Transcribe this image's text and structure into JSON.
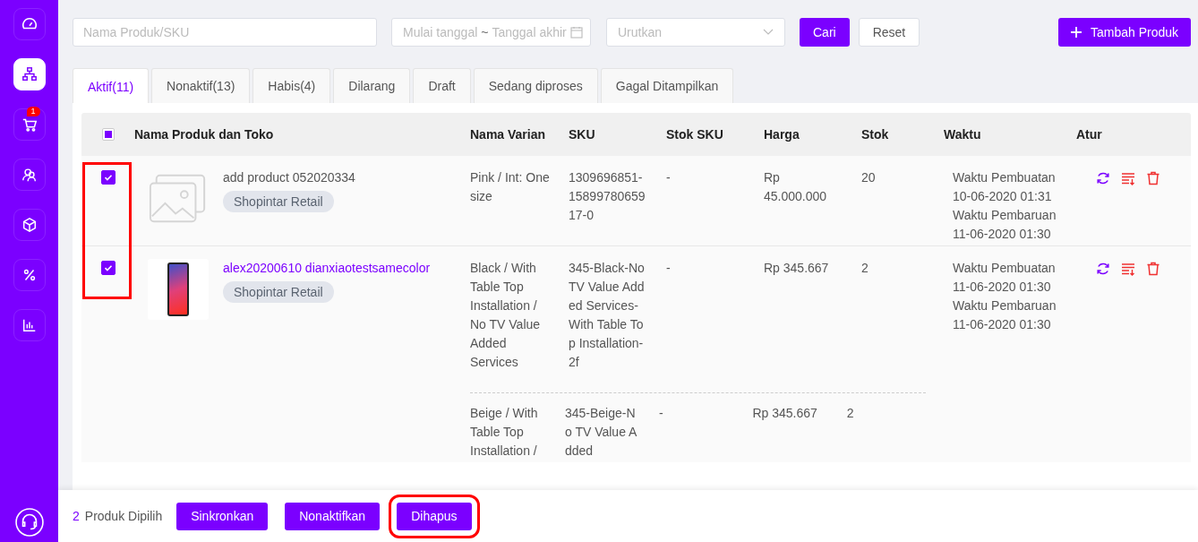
{
  "sidebar": {
    "items": [
      {
        "selected": false
      },
      {
        "selected": true
      },
      {
        "selected": false,
        "badge": "1"
      },
      {
        "selected": false
      },
      {
        "selected": false
      },
      {
        "selected": false
      },
      {
        "selected": false
      }
    ]
  },
  "filters": {
    "search": {
      "placeholder": "Nama Produk/SKU"
    },
    "date_start": {
      "placeholder": "Mulai tanggal"
    },
    "date_separator": "~",
    "date_end": {
      "placeholder": "Tanggal akhir"
    },
    "sort": {
      "placeholder": "Urutkan"
    },
    "search_button": "Cari",
    "reset_button": "Reset",
    "add_button": "Tambah Produk"
  },
  "tabs": [
    {
      "label": "Aktif(11)",
      "selected": true
    },
    {
      "label": "Nonaktif(13)",
      "selected": false
    },
    {
      "label": "Habis(4)",
      "selected": false
    },
    {
      "label": "Dilarang",
      "selected": false
    },
    {
      "label": "Draft",
      "selected": false
    },
    {
      "label": "Sedang diproses",
      "selected": false
    },
    {
      "label": "Gagal Ditampilkan",
      "selected": false
    }
  ],
  "table": {
    "select_all": {
      "indeterminate": true
    },
    "columns": [
      "Nama Produk dan Toko",
      "Nama Varian",
      "SKU",
      "Stok SKU",
      "Harga",
      "Stok",
      "Waktu",
      "Atur"
    ],
    "rows": [
      {
        "checked": true,
        "kind": "no-image",
        "name": "add product 052020334",
        "highlighted": false,
        "shop": "Shopintar Retail",
        "variants": [
          {
            "name": "Pink / Int: One size",
            "sku": "1309696851-1589978065917-0",
            "sku_stock": "-",
            "price": "Rp 45.000.000",
            "stock": "20"
          }
        ],
        "created_label": "Waktu Pembuatan",
        "created": "10-06-2020 01:31",
        "updated_label": "Waktu Pembaruan",
        "updated": "11-06-2020 01:30"
      },
      {
        "checked": true,
        "kind": "photo",
        "name": "alex20200610 dianxiaotestsamecolor",
        "highlighted": true,
        "shop": "Shopintar Retail",
        "variants": [
          {
            "name": "Black / With Table Top Installation / No TV Value Added Services",
            "sku": "345-Black-No TV Value Added Services-With Table Top Installation-2f",
            "sku_stock": "-",
            "price": "Rp 345.667",
            "stock": "2"
          },
          {
            "name": "Beige / With Table Top Installation /",
            "sku": "345-Beige-No TV Value Added",
            "sku_stock": "-",
            "price": "Rp 345.667",
            "stock": "2"
          }
        ],
        "created_label": "Waktu Pembuatan",
        "created": "11-06-2020 01:30",
        "updated_label": "Waktu Pembaruan",
        "updated": "11-06-2020 01:30"
      }
    ]
  },
  "bulk_bar": {
    "count": "2",
    "label": "Produk Dipilih",
    "buttons": [
      "Sinkronkan",
      "Nonaktifkan",
      "Dihapus"
    ]
  }
}
